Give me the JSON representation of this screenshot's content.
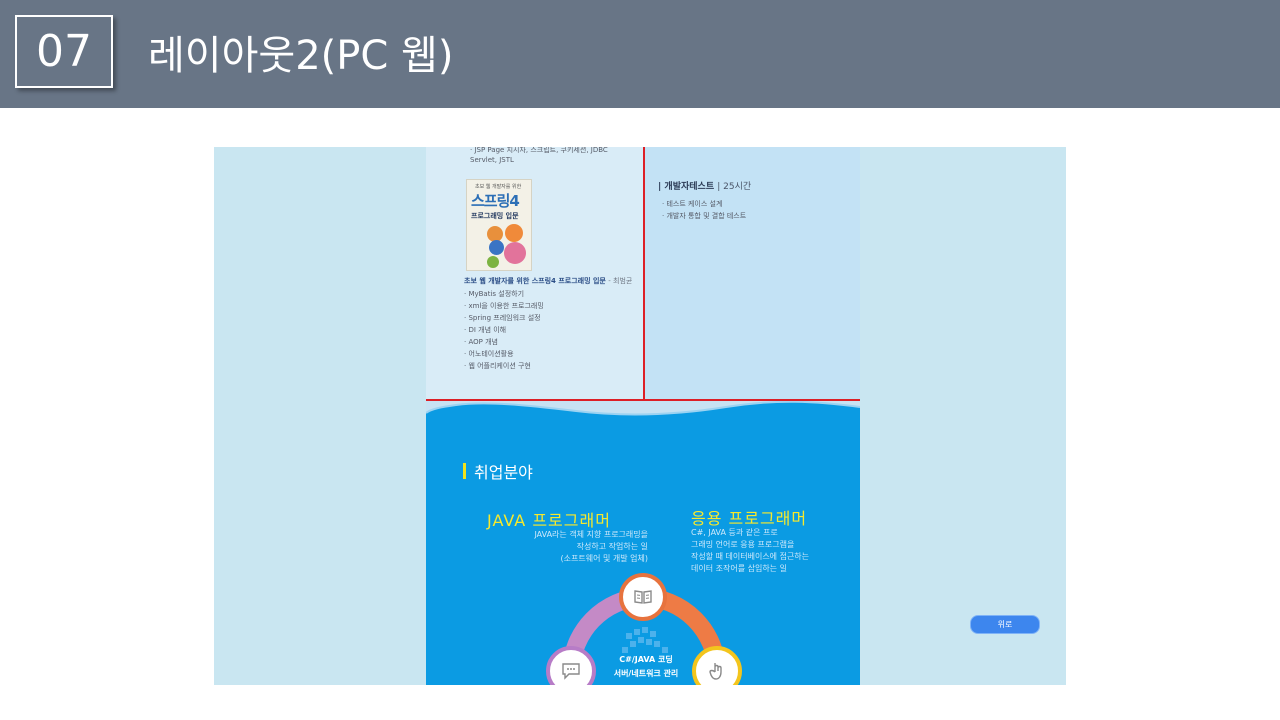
{
  "slide": {
    "number": "07",
    "title": "레이아웃2(PC 웹)"
  },
  "left_column": {
    "jsp_line": "· JSP Page 지시자, 스크립트, 쿠키세션, JDBC",
    "servlet_line": "Servlet, JSTL",
    "book": {
      "small_text": "초보 웹 개발자를 위한",
      "title": "스프링4",
      "subtitle": "프로그래밍 입문"
    },
    "book_caption": "초보 웹 개발자를 위한 스프링4 프로그래밍 입문",
    "book_author": "- 최범균",
    "items": [
      "· MyBatis 설정하기",
      "· xml을 이용한 프로그래밍",
      "· Spring 프레임워크 설정",
      "· DI 개념 이해",
      "· AOP 개념",
      "· 어노테이션활용",
      "· 웹 어플리케이션 구현"
    ]
  },
  "right_column": {
    "heading": "| 개발자테스트",
    "hours": "| 25시간",
    "items": [
      "· 테스트 케이스 설계",
      "· 개발자 통합 및 결합 테스트"
    ]
  },
  "jobs": {
    "title": "취업분야",
    "java": {
      "title": "JAVA 프로그래머",
      "desc": [
        "JAVA라는 객체 지향 프로그래밍을",
        "작성하고 작업하는 일",
        "(소프트웨어 및 개발 업체)"
      ]
    },
    "app": {
      "title": "응용 프로그래머",
      "desc": [
        "C#, JAVA 등과 같은 프로",
        "그래밍 언어로 응용 프로그램을",
        "작성할 때 데이터베이스에 접근하는",
        "데이터 조작어를 삽입하는 일"
      ]
    },
    "center": [
      "C#/JAVA 코딩",
      "서버/네트워크 관리"
    ],
    "nodes": [
      "book-icon",
      "chat-icon",
      "hand-pointer-icon"
    ]
  },
  "top_button": "위로",
  "colors": {
    "header_bg": "#687586",
    "page_bg": "#c9e6f1",
    "blue_section": "#0b9be3",
    "highlight_red": "#dd1f26",
    "title_yellow": "#f7e92c",
    "button_blue": "#3d86ee"
  }
}
